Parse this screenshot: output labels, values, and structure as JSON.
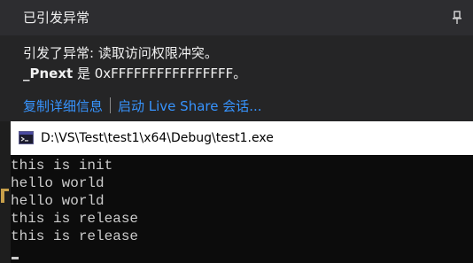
{
  "exception_popup": {
    "title": "已引发异常",
    "message_line1": "引发了异常: 读取访问权限冲突。",
    "message_line2_bold": "_Pnext",
    "message_line2_rest": " 是 0xFFFFFFFFFFFFFFFF。",
    "link_copy_details": "复制详细信息",
    "link_live_share": "启动 Live Share 会话...",
    "pin_icon": "pin-icon"
  },
  "console_window": {
    "title": "D:\\VS\\Test\\test1\\x64\\Debug\\test1.exe",
    "app_icon": "console-app-icon",
    "lines": [
      "this is init",
      "hello world",
      "hello world",
      "this is release",
      "this is release"
    ]
  },
  "colors": {
    "link": "#3794ff",
    "popup_background": "#252526",
    "console_background": "#0c0c0c",
    "console_text": "#cccccc"
  }
}
